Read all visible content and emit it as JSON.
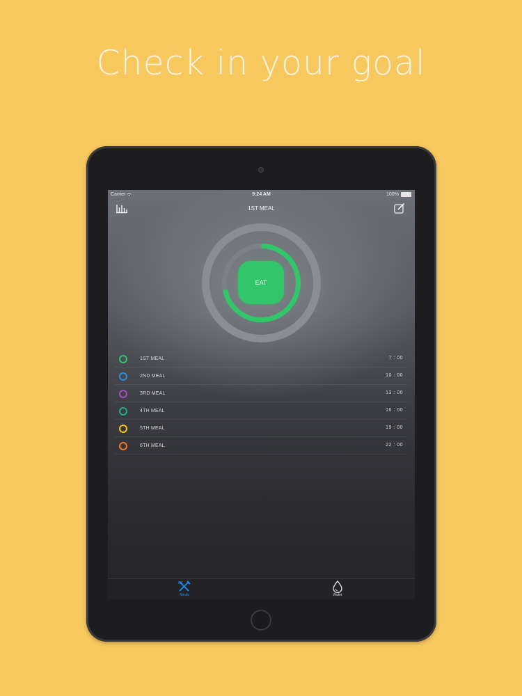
{
  "headline": "Check in your goal",
  "status_bar": {
    "carrier": "Carrier",
    "time": "9:24 AM",
    "battery": "100%"
  },
  "nav": {
    "title": "1ST MEAL",
    "left_icon": "bar-chart-icon",
    "right_icon": "edit-icon"
  },
  "progress": {
    "center_label": "EAT",
    "fraction": 0.72,
    "accent_color": "#31c66a"
  },
  "meals": [
    {
      "name": "1ST MEAL",
      "time": "7 : 00",
      "color": "#31c66a"
    },
    {
      "name": "2ND MEAL",
      "time": "10 : 00",
      "color": "#2f8fd6"
    },
    {
      "name": "3RD MEAL",
      "time": "13 : 00",
      "color": "#a34fc2"
    },
    {
      "name": "4TH MEAL",
      "time": "16 : 00",
      "color": "#1fae85"
    },
    {
      "name": "5TH MEAL",
      "time": "19 : 00",
      "color": "#f2c51b"
    },
    {
      "name": "6TH MEAL",
      "time": "22 : 00",
      "color": "#ef7d22"
    }
  ],
  "tabs": [
    {
      "label": "Meals",
      "icon": "fork-knife-icon",
      "active": true
    },
    {
      "label": "Water",
      "icon": "water-drop-icon",
      "active": false
    }
  ]
}
